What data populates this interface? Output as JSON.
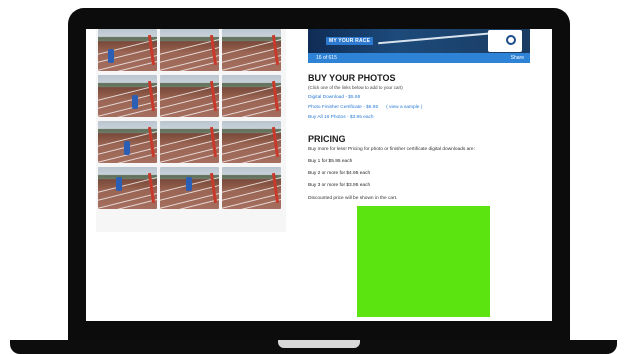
{
  "banner": {
    "brand": "MY YOUR RACE",
    "counter": "16 of 615",
    "share": "Share"
  },
  "buy": {
    "title": "BUY YOUR PHOTOS",
    "subtitle": "(Click one of the links below to add to your cart)",
    "links": [
      {
        "label": "Digital Download - $5.95"
      },
      {
        "label": "Photo Finisher Certificate - $5.95",
        "extra": "( view a sample )"
      },
      {
        "label": "Buy All 16 Photos - $3.95 each"
      }
    ]
  },
  "pricing": {
    "title": "PRICING",
    "description": "Buy more for less! Pricing for photo or finisher certificate digital downloads are:",
    "tiers": [
      "Buy 1 for $5.95 each",
      "Buy 2 or more for $4.95 each",
      "Buy 3 or more for $3.95 each"
    ],
    "note": "Discounted price will be shown in the cart."
  },
  "colors": {
    "accent": "#2f83d6",
    "highlight": "#5be40f",
    "laptop": "#0c0c0c"
  },
  "gallery": {
    "thumbnail_count": 12
  }
}
